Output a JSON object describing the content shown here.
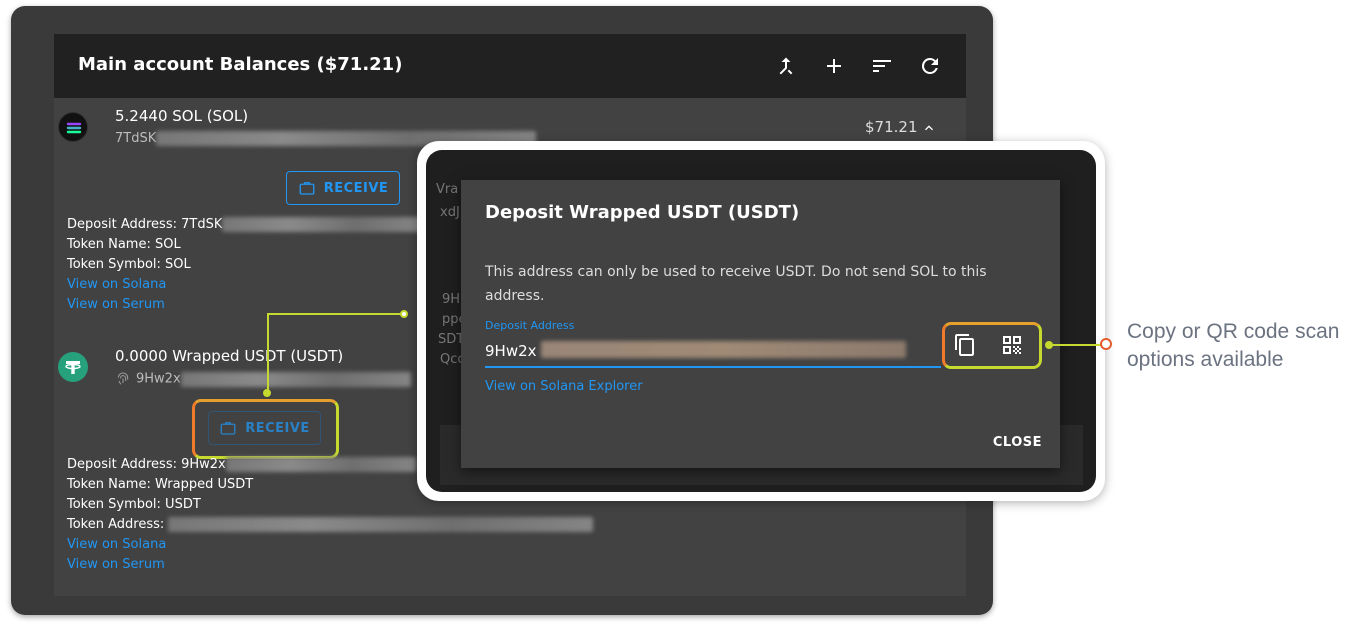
{
  "header": {
    "title": "Main account Balances ($71.21)",
    "icons": [
      "merge-icon",
      "add-icon",
      "sort-icon",
      "refresh-icon"
    ]
  },
  "sol_token": {
    "name": "5.2440 SOL (SOL)",
    "address_prefix": "7TdSK",
    "value": "$71.21",
    "receive_label": "RECEIVE",
    "deposit_label": "Deposit Address: 7TdSK",
    "token_name": "Token Name: SOL",
    "token_symbol": "Token Symbol: SOL",
    "link_solana": "View on Solana",
    "link_serum": "View on Serum"
  },
  "usdt_token": {
    "name": "0.0000 Wrapped USDT (USDT)",
    "address_prefix": "9Hw2x",
    "receive_label": "RECEIVE",
    "deposit_label": "Deposit Address: 9Hw2x",
    "token_name": "Token Name: Wrapped USDT",
    "token_symbol": "Token Symbol: USDT",
    "token_address": "Token Address:",
    "link_solana": "View on Solana",
    "link_serum": "View on Serum"
  },
  "modal": {
    "title": "Deposit Wrapped USDT (USDT)",
    "description": "This address can only be used to receive USDT. Do not send SOL to this address.",
    "field_label": "Deposit Address",
    "field_value": "9Hw2x",
    "explorer_link": "View on Solana Explorer",
    "close_label": "CLOSE",
    "bg_fragments": [
      "Vra",
      "xdJ",
      "9H",
      "ppe",
      "SDT",
      "Qcc"
    ]
  },
  "annotation": {
    "line1": "Copy or QR code scan",
    "line2": "options available"
  },
  "colors": {
    "accent": "#2196f3",
    "highlight": "#c5d92f",
    "highlight_warm": "#f07b2b",
    "callout_dot": "#e25c2d"
  }
}
